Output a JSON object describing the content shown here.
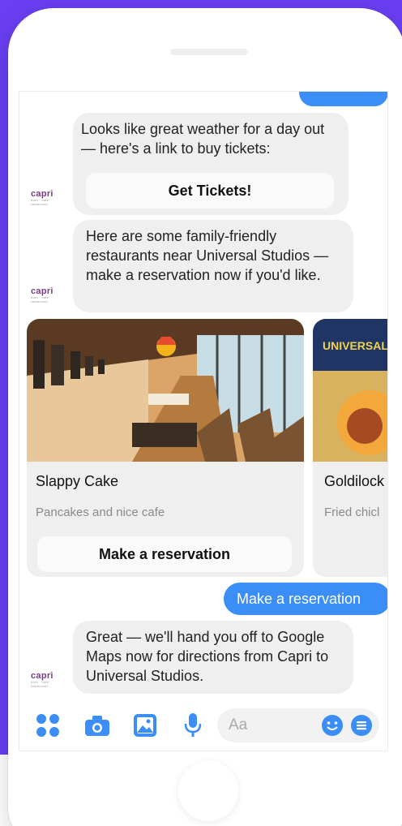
{
  "colors": {
    "background_accent": "#6a3ff3",
    "messenger_blue": "#3a8ef6",
    "bubble_gray": "#efefef",
    "brand_purple": "#7a3c8a"
  },
  "bot": {
    "avatar_label": "capri",
    "avatar_tagline": "food · cafe · restaurant"
  },
  "messages": [
    {
      "from": "bot",
      "text": "Looks like great weather for a day out — here's a link to buy tickets:",
      "button": "Get Tickets!"
    },
    {
      "from": "bot",
      "text": "Here are some family-friendly restaurants near Universal Studios — make a reservation now if you'd like."
    },
    {
      "from": "user",
      "text": "Make a reservation"
    },
    {
      "from": "bot",
      "text": "Great — we'll hand you off to Google Maps now for directions from Capri to Universal Studios."
    }
  ],
  "carousel": [
    {
      "title": "Slappy Cake",
      "subtitle": "Pancakes and nice cafe",
      "button": "Make a reservation"
    },
    {
      "title": "Goldilock",
      "subtitle": "Fried chicl",
      "sign_text": "UNIVERSAL STUDIOS"
    }
  ],
  "composer": {
    "placeholder": "Aa",
    "icons": [
      "more-apps-icon",
      "camera-icon",
      "photo-icon",
      "microphone-icon",
      "emoji-icon",
      "menu-icon"
    ]
  }
}
